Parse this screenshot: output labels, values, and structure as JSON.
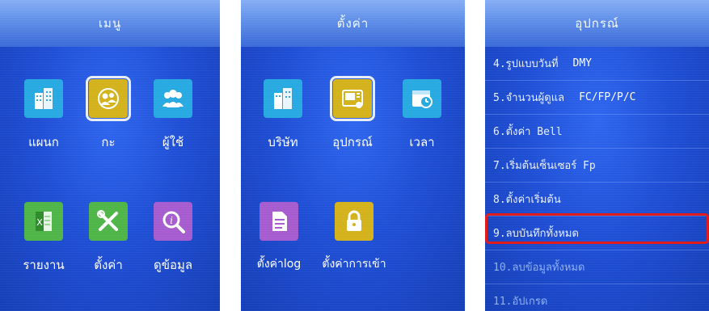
{
  "menu_screen": {
    "title": "เมนู",
    "items": [
      {
        "label": "แผนก",
        "icon": "building-icon",
        "color": "#27a9e1"
      },
      {
        "label": "กะ",
        "icon": "shift-people-icon",
        "color": "#d3b21c"
      },
      {
        "label": "ผู้ใช้",
        "icon": "users-icon",
        "color": "#27a9e1"
      },
      {
        "label": "รายงาน",
        "icon": "excel-report-icon",
        "color": "#4fb548"
      },
      {
        "label": "ตั้งค่า",
        "icon": "tools-icon",
        "color": "#4fb548"
      },
      {
        "label": "ดูข้อมูล",
        "icon": "info-search-icon",
        "color": "#a65ccf"
      }
    ]
  },
  "settings_screen": {
    "title": "ตั้งค่า",
    "items": [
      {
        "label": "บริษัท",
        "icon": "company-building-icon",
        "color": "#27a9e1"
      },
      {
        "label": "อุปกรณ์",
        "icon": "device-icon",
        "color": "#d3b21c"
      },
      {
        "label": "เวลา",
        "icon": "calendar-clock-icon",
        "color": "#27a9e1"
      },
      {
        "label": "ตั้งค่าlog",
        "icon": "document-icon",
        "color": "#a65ccf"
      },
      {
        "label": "ตั้งค่าการเข้า",
        "icon": "lock-icon",
        "color": "#d3b21c"
      }
    ]
  },
  "device_screen": {
    "title": "อุปกรณ์",
    "rows": [
      {
        "label": "4.รูปแบบวันที่",
        "value": "DMY"
      },
      {
        "label": "5.จำนวนผู้ดูแล",
        "value": "FC/FP/P/C"
      },
      {
        "label": "6.ตั้งค่า Bell",
        "value": ""
      },
      {
        "label": "7.เริ่มต้นเซ็นเซอร์ Fp",
        "value": ""
      },
      {
        "label": "8.ตั้งค่าเริ่มต้น",
        "value": ""
      },
      {
        "label": "9.ลบบันทึกทั้งหมด",
        "value": ""
      },
      {
        "label": "10.ลบข้อมูลทั้งหมด",
        "value": ""
      },
      {
        "label": "11.อัปเกรด",
        "value": ""
      }
    ],
    "highlight_color": "#e21b1b"
  }
}
